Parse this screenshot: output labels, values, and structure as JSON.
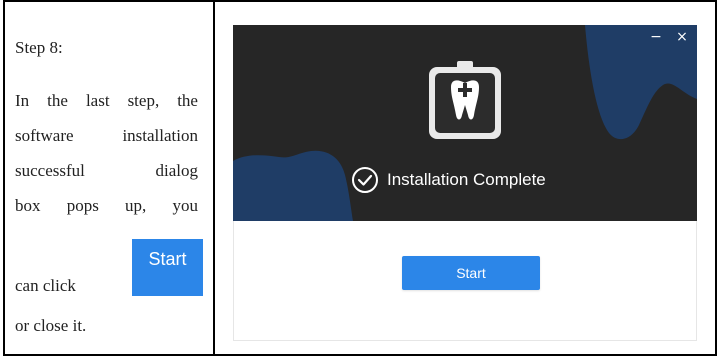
{
  "doc": {
    "step_heading": "Step 8:",
    "lines": [
      [
        "In",
        "the",
        "last",
        "step,",
        "the"
      ],
      [
        "software",
        "installation"
      ],
      [
        "successful",
        "dialog"
      ],
      [
        "box",
        "pops",
        "up,",
        "you"
      ]
    ],
    "can_click": "can click",
    "close_text": "or close it.",
    "inline_button_label": "Start"
  },
  "dialog": {
    "minimize_icon": "−",
    "close_icon": "×",
    "status_text": "Installation Complete",
    "start_label": "Start",
    "colors": {
      "header_bg": "#262626",
      "accent_blob": "#1f3d66",
      "button": "#2c86e8"
    }
  }
}
